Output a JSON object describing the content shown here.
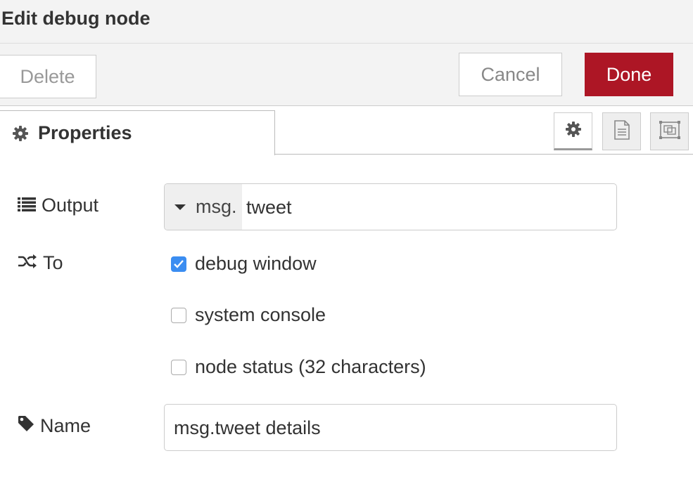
{
  "dialog": {
    "title": "Edit debug node"
  },
  "toolbar": {
    "delete_label": "Delete",
    "cancel_label": "Cancel",
    "done_label": "Done",
    "done_color": "#ad1625"
  },
  "tabs": {
    "properties_label": "Properties",
    "icons": [
      "gear-icon",
      "description-icon",
      "appearance-icon"
    ]
  },
  "form": {
    "output": {
      "label": "Output",
      "type_prefix": "msg.",
      "value": "tweet"
    },
    "to": {
      "label": "To",
      "options": [
        {
          "label": "debug window",
          "checked": true
        },
        {
          "label": "system console",
          "checked": false
        },
        {
          "label": "node status (32 characters)",
          "checked": false
        }
      ]
    },
    "name": {
      "label": "Name",
      "value": "msg.tweet details"
    }
  }
}
